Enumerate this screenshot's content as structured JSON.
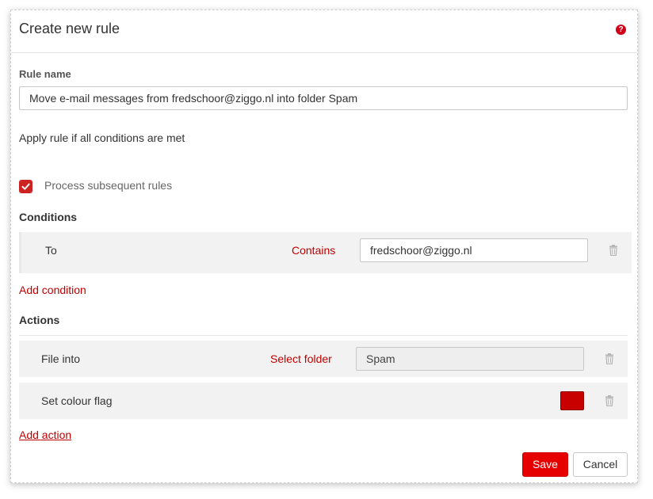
{
  "dialog": {
    "title": "Create new rule",
    "help_icon": "help-icon",
    "help_glyph": "?"
  },
  "rule_name": {
    "label": "Rule name",
    "value": "Move e-mail messages from fredschoor@ziggo.nl into folder Spam"
  },
  "apply_rule_text": "Apply rule if all conditions are met",
  "process_subsequent": {
    "label": "Process subsequent rules",
    "checked": true
  },
  "conditions": {
    "title": "Conditions",
    "items": [
      {
        "field": "To",
        "operator": "Contains",
        "value": "fredschoor@ziggo.nl",
        "delete_icon": "trash-icon"
      }
    ],
    "add_label": "Add condition"
  },
  "actions": {
    "title": "Actions",
    "items": [
      {
        "label": "File into",
        "link": "Select folder",
        "value": "Spam",
        "delete_icon": "trash-icon"
      },
      {
        "label": "Set colour flag",
        "color": "#c80000",
        "delete_icon": "trash-icon"
      }
    ],
    "add_label": "Add action"
  },
  "buttons": {
    "save": "Save",
    "cancel": "Cancel"
  },
  "colors": {
    "accent": "#e60000",
    "link": "#c00000"
  }
}
